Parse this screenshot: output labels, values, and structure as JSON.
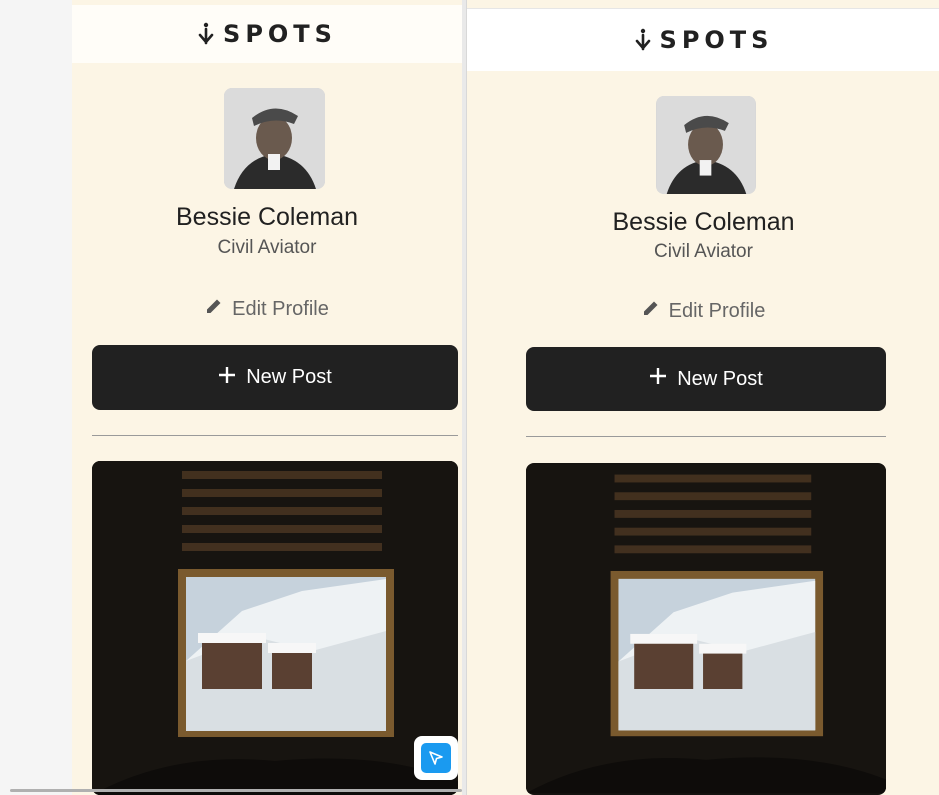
{
  "app": {
    "logo_text": "SPOTS"
  },
  "profile": {
    "name": "Bessie Coleman",
    "role": "Civil Aviator",
    "edit_label": "Edit Profile"
  },
  "actions": {
    "new_post_label": "New Post"
  },
  "icons": [
    "spots-logo-icon",
    "pencil-icon",
    "plus-icon",
    "cursor-pointer-icon"
  ],
  "colors": {
    "background": "#fcf5e5",
    "button": "#212121",
    "header": "#ffffff",
    "pointer_accent": "#1a9af0"
  }
}
